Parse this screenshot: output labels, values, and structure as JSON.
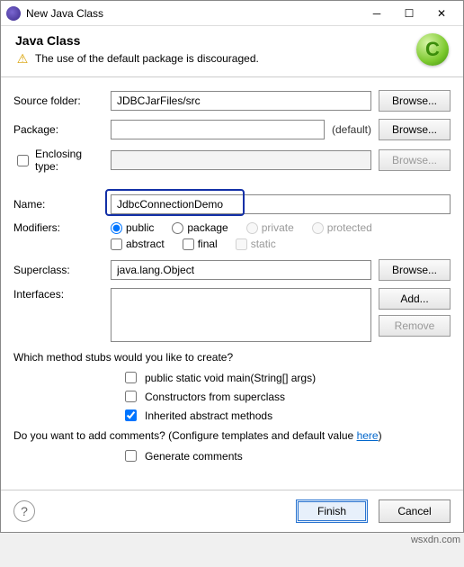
{
  "window": {
    "title": "New Java Class"
  },
  "header": {
    "title": "Java Class",
    "warning": "The use of the default package is discouraged."
  },
  "labels": {
    "source_folder": "Source folder:",
    "package": "Package:",
    "default": "(default)",
    "enclosing_type": "Enclosing type:",
    "name": "Name:",
    "modifiers": "Modifiers:",
    "superclass": "Superclass:",
    "interfaces": "Interfaces:",
    "browse": "Browse...",
    "add": "Add...",
    "remove": "Remove"
  },
  "values": {
    "source_folder": "JDBCJarFiles/src",
    "name": "JdbcConnectionDemo",
    "superclass": "java.lang.Object"
  },
  "modifiers": {
    "public": "public",
    "package": "package",
    "private": "private",
    "protected": "protected",
    "abstract": "abstract",
    "final": "final",
    "static": "static"
  },
  "stubs": {
    "question": "Which method stubs would you like to create?",
    "main": "public static void main(String[] args)",
    "superctor": "Constructors from superclass",
    "inherited": "Inherited abstract methods"
  },
  "comments": {
    "question_pre": "Do you want to add comments? (Configure templates and default value ",
    "here": "here",
    "question_post": ")",
    "generate": "Generate comments"
  },
  "footer": {
    "finish": "Finish",
    "cancel": "Cancel"
  },
  "watermark": "wsxdn.com"
}
